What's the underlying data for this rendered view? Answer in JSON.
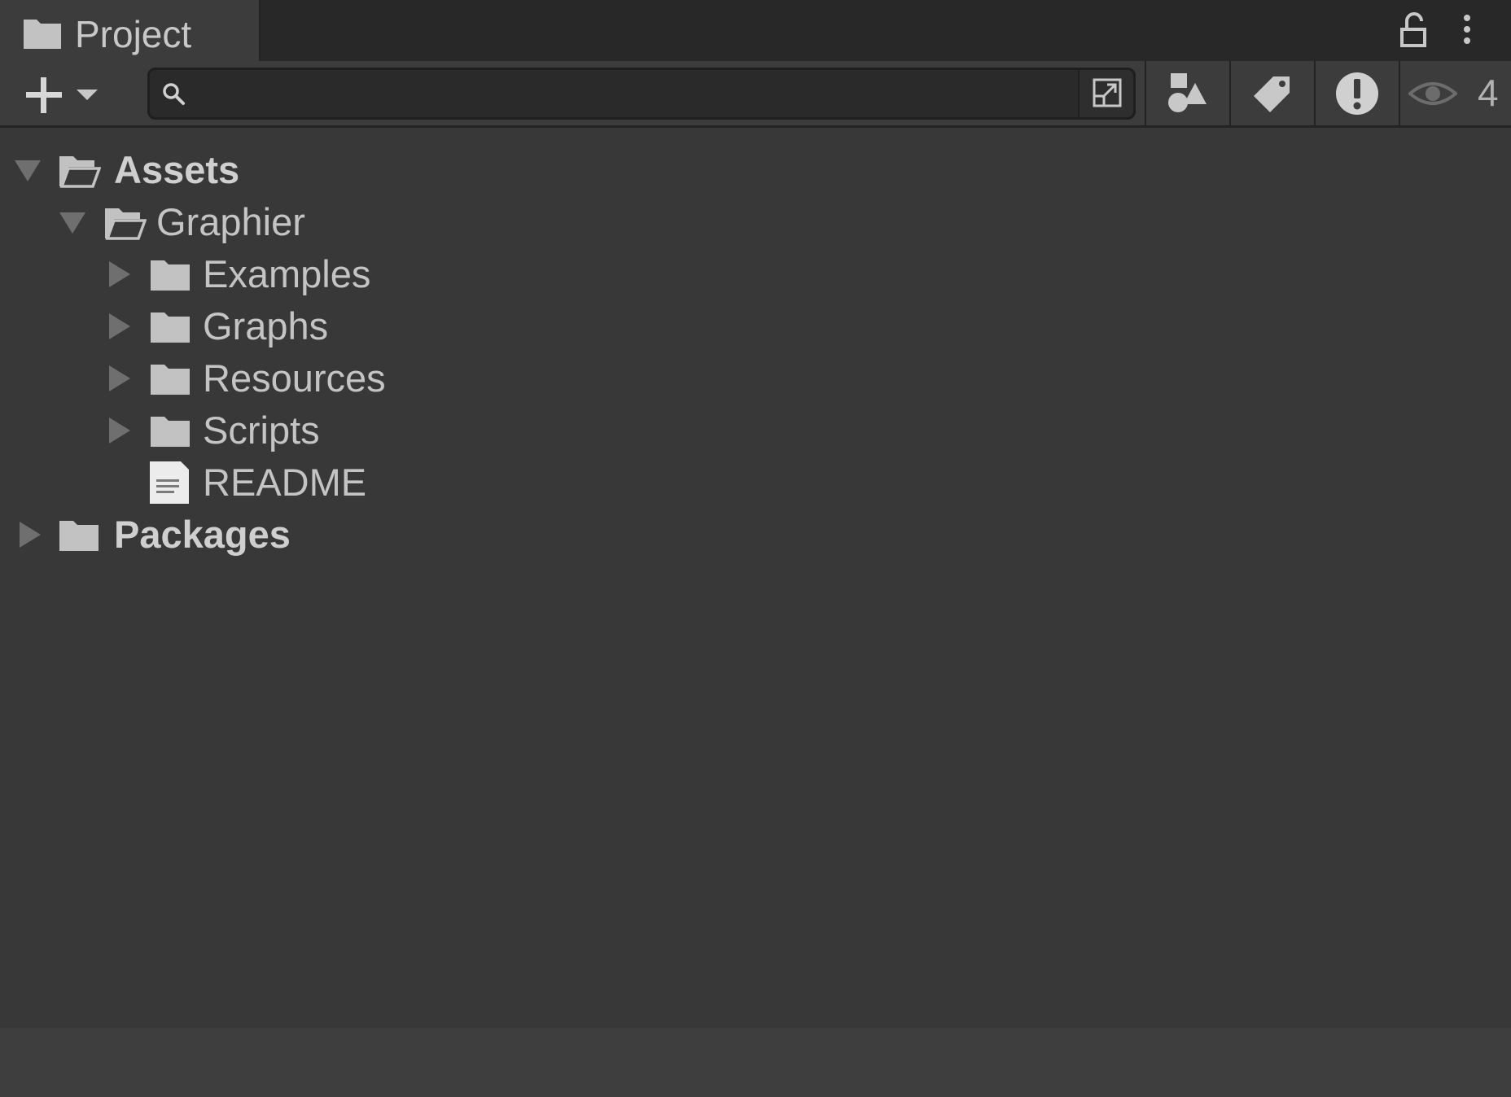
{
  "window": {
    "tab_title": "Project"
  },
  "toolbar": {
    "search": {
      "value": "",
      "placeholder": ""
    },
    "hidden_packages_count": "4"
  },
  "tree": [
    {
      "label": "Assets",
      "type": "folder-open",
      "expanded": true,
      "bold": true
    },
    {
      "label": "Graphier",
      "type": "folder-open",
      "expanded": true,
      "bold": false
    },
    {
      "label": "Examples",
      "type": "folder",
      "expanded": false,
      "bold": false
    },
    {
      "label": "Graphs",
      "type": "folder",
      "expanded": false,
      "bold": false
    },
    {
      "label": "Resources",
      "type": "folder",
      "expanded": false,
      "bold": false
    },
    {
      "label": "Scripts",
      "type": "folder",
      "expanded": false,
      "bold": false
    },
    {
      "label": "README",
      "type": "text-file",
      "expanded": null,
      "bold": false
    },
    {
      "label": "Packages",
      "type": "folder",
      "expanded": false,
      "bold": true
    }
  ],
  "colors": {
    "background": "#383838",
    "tab_bar": "#282828",
    "toolbar": "#3c3c3c",
    "search_field": "#2a2a2a",
    "text": "#c4c4c4",
    "folder_icon": "#c2c2c2",
    "arrow": "#6f6f6f"
  },
  "icons": {
    "tab": "folder-icon",
    "lock": "lock-icon",
    "menu": "kebab-menu-icon",
    "create": "plus-icon",
    "search": "search-icon",
    "search_popout": "popout-icon",
    "type_filter": "shapes-icon",
    "label_filter": "tag-icon",
    "log_filter": "exclamation-icon",
    "visibility": "eye-icon"
  }
}
